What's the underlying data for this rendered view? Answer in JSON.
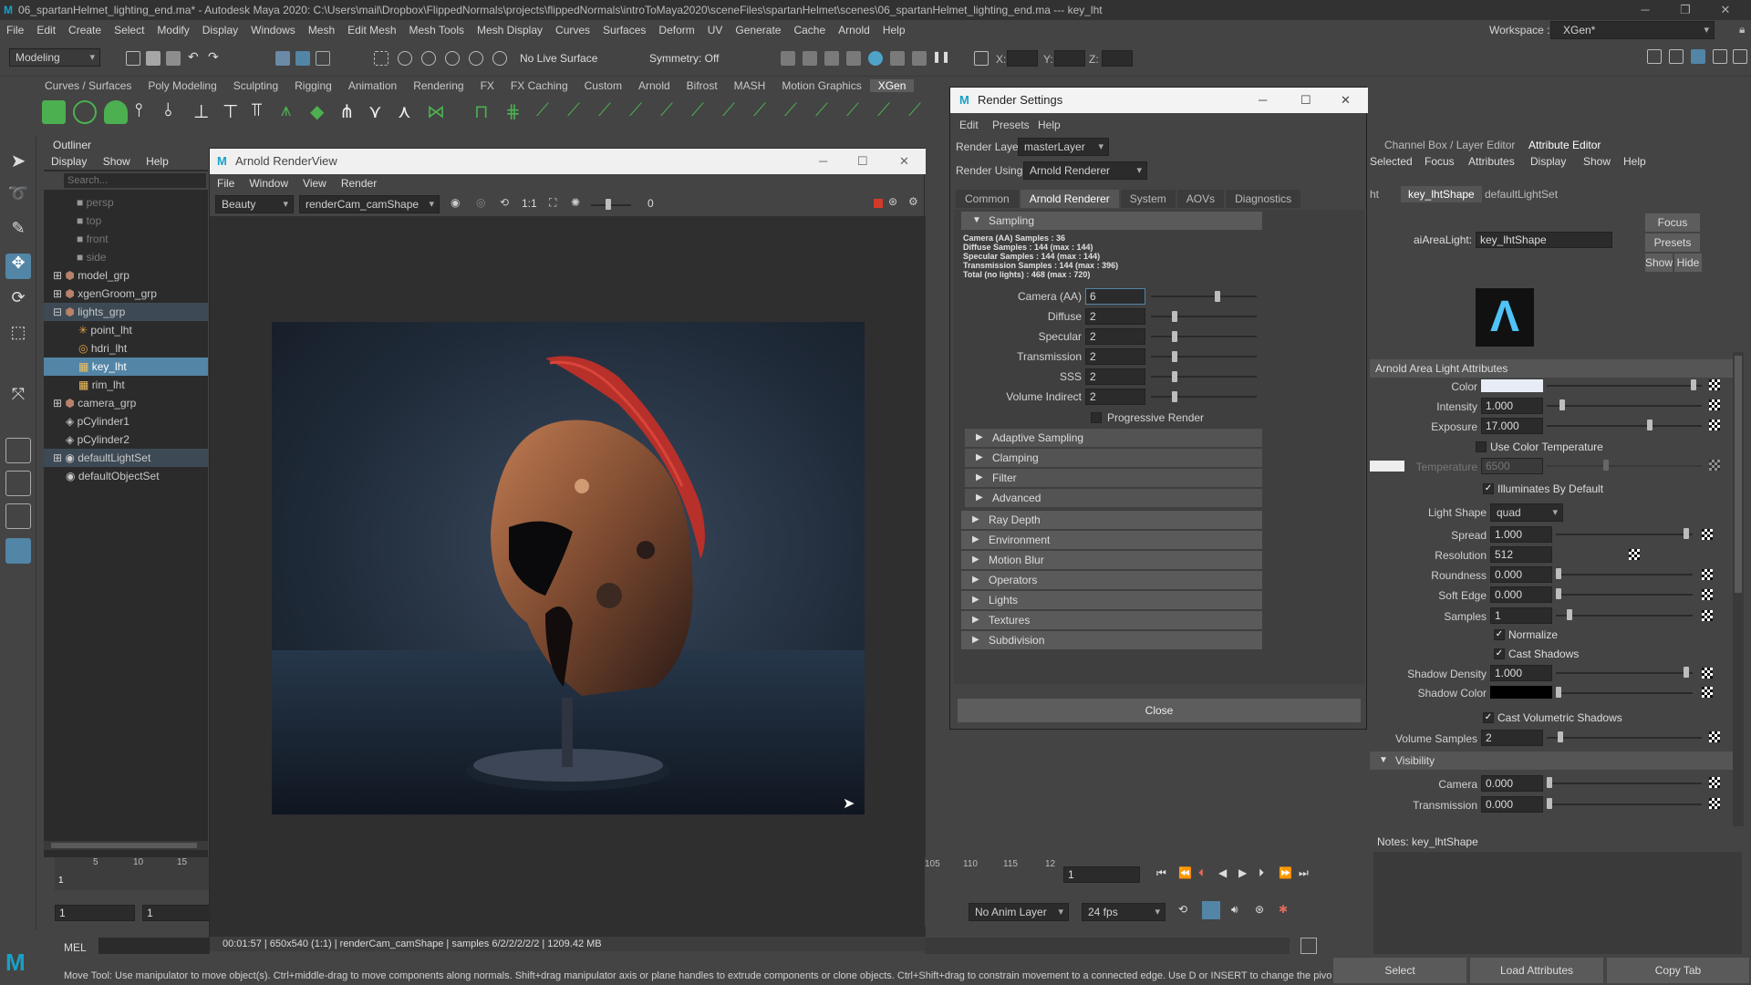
{
  "app": {
    "title": "06_spartanHelmet_lighting_end.ma* - Autodesk Maya 2020: C:\\Users\\mail\\Dropbox\\FlippedNormals\\projects\\flippedNormals\\introToMaya2020\\sceneFiles\\spartanHelmet\\scenes\\06_spartanHelmet_lighting_end.ma --- key_lht"
  },
  "menubar": [
    "File",
    "Edit",
    "Create",
    "Select",
    "Modify",
    "Display",
    "Windows",
    "Mesh",
    "Edit Mesh",
    "Mesh Tools",
    "Mesh Display",
    "Curves",
    "Surfaces",
    "Deform",
    "UV",
    "Generate",
    "Cache",
    "Arnold",
    "Help"
  ],
  "workspace": {
    "label": "Workspace :",
    "value": "XGen*"
  },
  "statusline": {
    "mode": "Modeling",
    "live_surface": "No Live Surface",
    "symmetry": "Symmetry: Off",
    "x": "X:",
    "y": "Y:",
    "z": "Z:"
  },
  "shelf_tabs": [
    "Curves / Surfaces",
    "Poly Modeling",
    "Sculpting",
    "Rigging",
    "Animation",
    "Rendering",
    "FX",
    "FX Caching",
    "Custom",
    "Arnold",
    "Bifrost",
    "MASH",
    "Motion Graphics",
    "XGen"
  ],
  "outliner": {
    "title": "Outliner",
    "menu": [
      "Display",
      "Show",
      "Help"
    ],
    "search_placeholder": "Search...",
    "items": [
      {
        "label": "persp"
      },
      {
        "label": "top"
      },
      {
        "label": "front"
      },
      {
        "label": "side"
      },
      {
        "label": "model_grp"
      },
      {
        "label": "xgenGroom_grp"
      },
      {
        "label": "lights_grp"
      },
      {
        "label": "point_lht"
      },
      {
        "label": "hdri_lht"
      },
      {
        "label": "key_lht"
      },
      {
        "label": "rim_lht"
      },
      {
        "label": "camera_grp"
      },
      {
        "label": "pCylinder1"
      },
      {
        "label": "pCylinder2"
      },
      {
        "label": "defaultLightSet"
      },
      {
        "label": "defaultObjectSet"
      }
    ]
  },
  "renderview": {
    "title": "Arnold RenderView",
    "menu": [
      "File",
      "Window",
      "View",
      "Render"
    ],
    "aov": "Beauty",
    "camera": "renderCam_camShape",
    "ratio": "1:1",
    "exposure": "0",
    "status": "00:01:57 | 650x540 (1:1) | renderCam_camShape | samples 6/2/2/2/2/2 | 1209.42 MB"
  },
  "render_settings": {
    "title": "Render Settings",
    "menu": [
      "Edit",
      "Presets",
      "Help"
    ],
    "render_layer_label": "Render Layer",
    "render_layer": "masterLayer",
    "render_using_label": "Render Using",
    "render_using": "Arnold Renderer",
    "tabs": [
      "Common",
      "Arnold Renderer",
      "System",
      "AOVs",
      "Diagnostics"
    ],
    "sampling_title": "Sampling",
    "summary": [
      "Camera (AA) Samples : 36",
      "Diffuse Samples : 144 (max : 144)",
      "Specular Samples : 144 (max : 144)",
      "Transmission Samples : 144 (max : 396)",
      "Total (no lights) : 468 (max : 720)"
    ],
    "fields": [
      {
        "label": "Camera (AA)",
        "value": "6",
        "level": 0.6
      },
      {
        "label": "Diffuse",
        "value": "2",
        "level": 0.2
      },
      {
        "label": "Specular",
        "value": "2",
        "level": 0.2
      },
      {
        "label": "Transmission",
        "value": "2",
        "level": 0.2
      },
      {
        "label": "SSS",
        "value": "2",
        "level": 0.2
      },
      {
        "label": "Volume Indirect",
        "value": "2",
        "level": 0.2
      }
    ],
    "progressive": "Progressive Render",
    "sub_sections": [
      "Adaptive Sampling",
      "Clamping",
      "Filter",
      "Advanced"
    ],
    "sections": [
      "Ray Depth",
      "Environment",
      "Motion Blur",
      "Operators",
      "Lights",
      "Textures",
      "Subdivision"
    ],
    "close": "Close"
  },
  "attribute_editor": {
    "tabs": [
      "Channel Box / Layer Editor",
      "Attribute Editor"
    ],
    "menu": [
      "Selected",
      "Focus",
      "Attributes",
      "Display",
      "Show",
      "Help"
    ],
    "node_tabs": [
      "ht",
      "key_lhtShape",
      "defaultLightSet"
    ],
    "node_label": "aiAreaLight:",
    "node_value": "key_lhtShape",
    "focus": "Focus",
    "presets": "Presets",
    "show": "Show",
    "hide": "Hide",
    "section_title": "Arnold Area Light Attributes",
    "color_label": "Color",
    "color_value": "#e8ecf6",
    "intensity_label": "Intensity",
    "intensity": "1.000",
    "exposure_label": "Exposure",
    "exposure": "17.000",
    "use_color_temp": "Use Color Temperature",
    "temperature_label": "Temperature",
    "temperature": "6500",
    "illuminates": "Illuminates By Default",
    "light_shape_label": "Light Shape",
    "light_shape": "quad",
    "spread_label": "Spread",
    "spread": "1.000",
    "resolution_label": "Resolution",
    "resolution": "512",
    "roundness_label": "Roundness",
    "roundness": "0.000",
    "soft_edge_label": "Soft Edge",
    "soft_edge": "0.000",
    "samples_label": "Samples",
    "samples": "1",
    "normalize": "Normalize",
    "cast_shadows": "Cast Shadows",
    "shadow_density_label": "Shadow Density",
    "shadow_density": "1.000",
    "shadow_color_label": "Shadow Color",
    "cast_vol_shadows": "Cast Volumetric Shadows",
    "volume_samples_label": "Volume Samples",
    "volume_samples": "2",
    "visibility_title": "Visibility",
    "camera_label": "Camera",
    "camera": "0.000",
    "transmission_label": "Transmission",
    "transmission": "0.000",
    "notes": "Notes:  key_lhtShape",
    "select_btn": "Select",
    "load_btn": "Load Attributes",
    "copy_btn": "Copy Tab"
  },
  "timeline": {
    "ticks": [
      "5",
      "10",
      "15"
    ],
    "current_frame": "1",
    "start": "1",
    "start2": "1",
    "right_ticks": [
      "105",
      "110",
      "115",
      "12"
    ],
    "right_frame": "1",
    "anim_layer": "No Anim Layer",
    "fps": "24 fps"
  },
  "command_line": {
    "lang": "MEL"
  },
  "helpline": "Move Tool: Use manipulator to move object(s). Ctrl+middle-drag to move components along normals. Shift+drag manipulator axis or plane handles to extrude components or clone objects. Ctrl+Shift+drag to constrain movement to a connected edge. Use D or INSERT to change the pivot position and axis orientat"
}
